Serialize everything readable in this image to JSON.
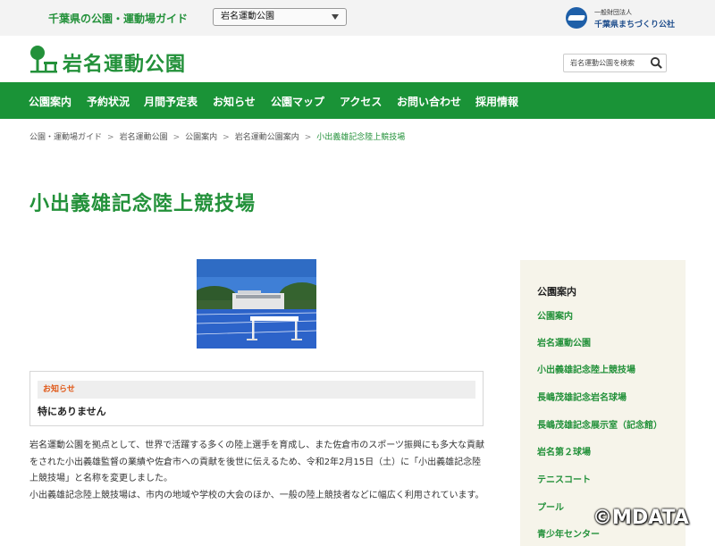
{
  "topbar": {
    "guide_title": "千葉県の公園・運動場ガイド",
    "park_select_value": "岩名運動公園",
    "org_sub": "一般財団法人",
    "org_name": "千葉県まちづくり公社"
  },
  "header": {
    "site_title": "岩名運動公園",
    "search_placeholder": "岩名運動公園を検索"
  },
  "nav": {
    "items": [
      "公園案内",
      "予約状況",
      "月間予定表",
      "お知らせ",
      "公園マップ",
      "アクセス",
      "お問い合わせ",
      "採用情報"
    ]
  },
  "breadcrumb": {
    "items": [
      "公園・運動場ガイド",
      "岩名運動公園",
      "公園案内",
      "岩名運動公園案内"
    ],
    "current": "小出義雄記念陸上競技場",
    "separator": ">"
  },
  "page": {
    "title": "小出義雄記念陸上競技場"
  },
  "notice": {
    "label": "お知らせ",
    "body": "特にありません"
  },
  "description": {
    "line1": "岩名運動公園を拠点として、世界で活躍する多くの陸上選手を育成し、また佐倉市のスポーツ振興にも多大な貢献をされた小出義雄監督の業績や佐倉市への貢献を後世に伝えるため、令和2年2月15日（土）に「小出義雄記念陸上競技場」と名称を変更しました。",
    "line2": "小出義雄記念陸上競技場は、市内の地域や学校の大会のほか、一般の陸上競技者などに幅広く利用されています。"
  },
  "sidebar": {
    "title": "公園案内",
    "links": [
      "公園案内",
      "岩名運動公園",
      "小出義雄記念陸上競技場",
      "長嶋茂雄記念岩名球場",
      "長嶋茂雄記念展示室（記念館）",
      "岩名第２球場",
      "テニスコート",
      "プール",
      "青少年センター"
    ]
  },
  "watermark": "©MDATA",
  "colors": {
    "brand_green": "#1a9337",
    "title_green": "#23913a",
    "notice_orange": "#e05a1a",
    "org_blue": "#1e5fa8",
    "sidebar_bg": "#f6f4ea"
  }
}
